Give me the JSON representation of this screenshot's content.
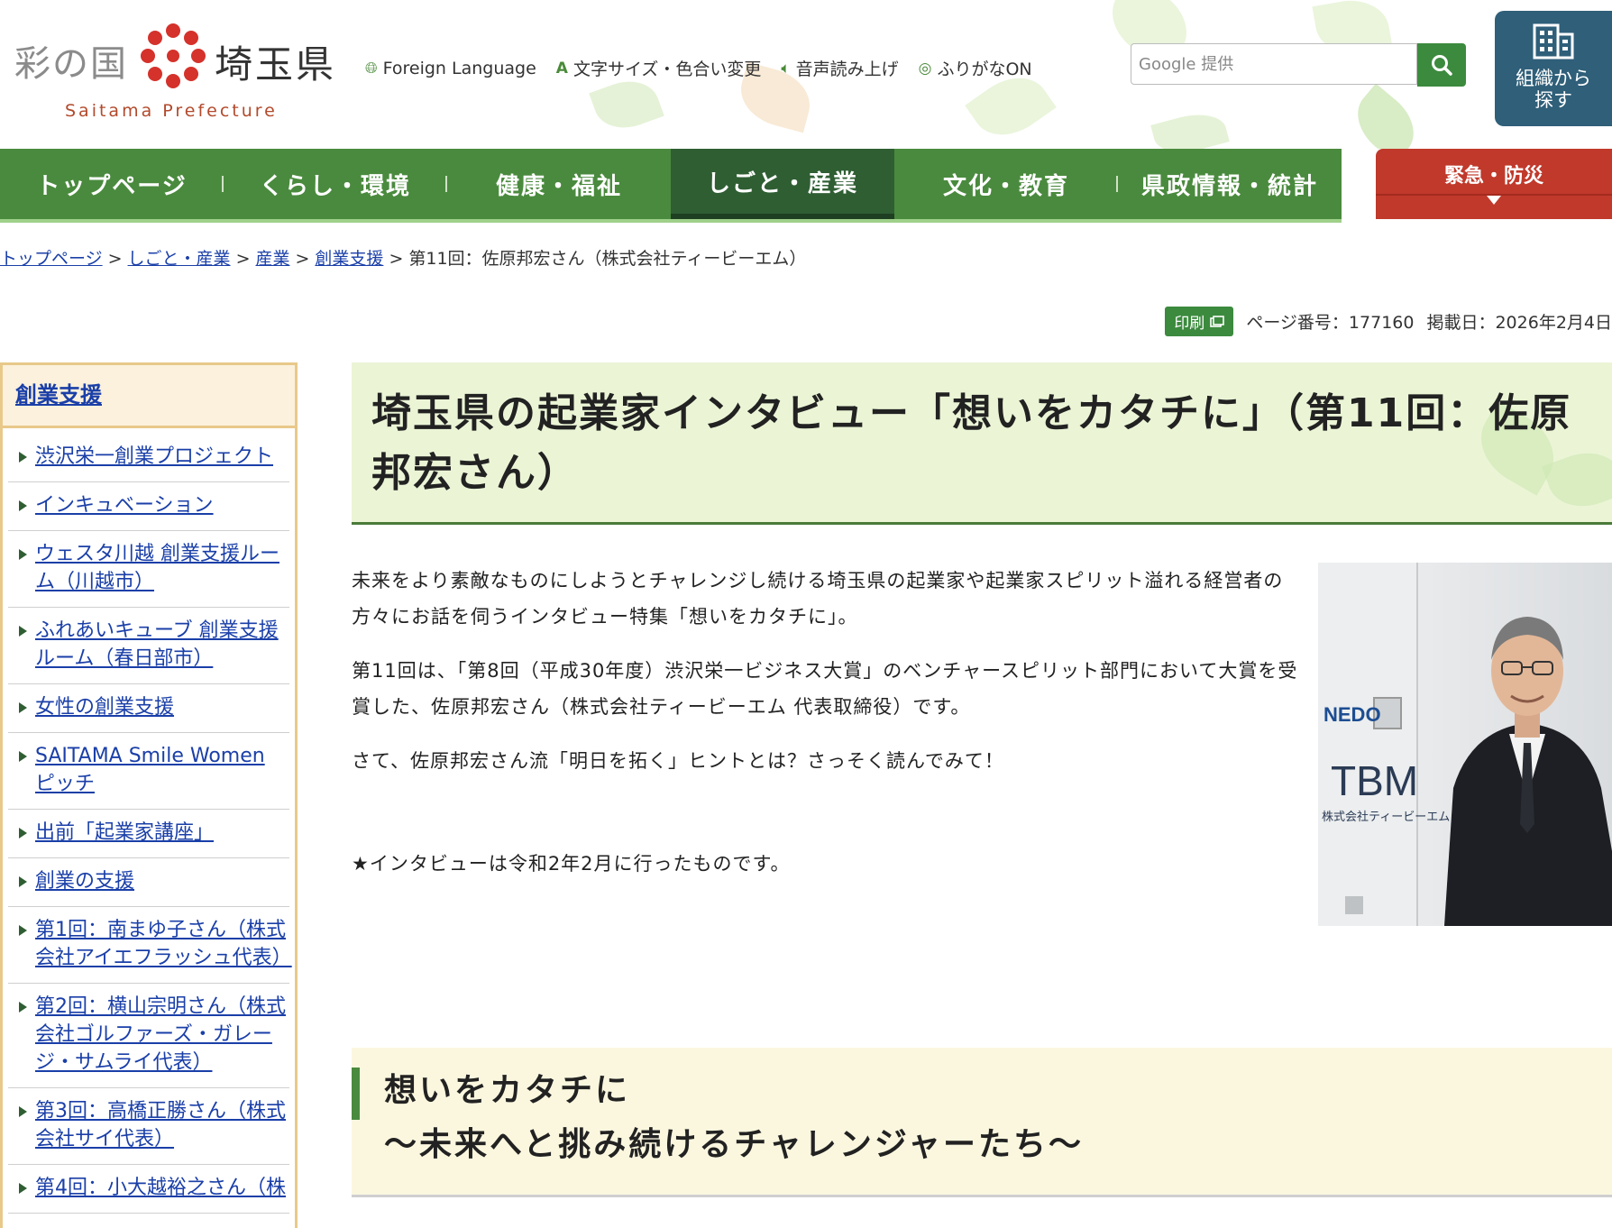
{
  "header": {
    "logo": {
      "left_text": "彩の国",
      "right_text": "埼玉県",
      "roman_text": "Saitama Prefecture"
    },
    "tools": [
      {
        "icon": "globe-icon",
        "label": "Foreign Language"
      },
      {
        "icon": "text-size-icon",
        "label": "文字サイズ・色合い変更"
      },
      {
        "icon": "speaker-icon",
        "label": "音声読み上げ"
      },
      {
        "icon": "furigana-icon",
        "label": "ふりがなON"
      }
    ],
    "search": {
      "placeholder": "Google 提供"
    },
    "org_button": {
      "label": "組織から探す"
    }
  },
  "nav": {
    "items": [
      "トップページ",
      "くらし・環境",
      "健康・福祉",
      "しごと・産業",
      "文化・教育",
      "県政情報・統計"
    ],
    "active": "しごと・産業",
    "emergency": "緊急・防災"
  },
  "breadcrumb": {
    "links": [
      "トップページ",
      "しごと・産業",
      "産業",
      "創業支援"
    ],
    "current": "第11回：佐原邦宏さん（株式会社ティービーエム）"
  },
  "meta": {
    "print": "印刷",
    "page_number": "ページ番号：177160",
    "published": "掲載日：2026年2月4日"
  },
  "sidebar": {
    "title": "創業支援",
    "items": [
      "渋沢栄一創業プロジェクト",
      "インキュベーション",
      "ウェスタ川越 創業支援ルーム（川越市）",
      "ふれあいキューブ 創業支援ルーム（春日部市）",
      "女性の創業支援",
      "SAITAMA Smile Women ピッチ",
      "出前「起業家講座」",
      "創業の支援",
      "第1回：南まゆ子さん（株式会社アイエフラッシュ代表）",
      "第2回：横山宗明さん（株式会社ゴルファーズ・ガレージ・サムライ代表）",
      "第3回：高橋正勝さん（株式会社サイ代表）",
      "第4回：小大越裕之さん（株"
    ]
  },
  "main": {
    "title": "埼玉県の起業家インタビュー「想いをカタチに」（第11回：佐原邦宏さん）",
    "paragraphs": [
      "未来をより素敵なものにしようとチャレンジし続ける埼玉県の起業家や起業家スピリット溢れる経営者の方々にお話を伺うインタビュー特集「想いをカタチに」。",
      "第11回は、「第8回（平成30年度）渋沢栄一ビジネス大賞」のベンチャースピリット部門において大賞を受賞した、佐原邦宏さん（株式会社ティービーエム 代表取締役）です。",
      "さて、佐原邦宏さん流「明日を拓く」ヒントとは？さっそく読んでみて！"
    ],
    "note": "★インタビューは令和2年2月に行ったものです。",
    "photo": {
      "nedo_text": "NEDO",
      "tbm_text": "TBM",
      "company_text": "株式会社ティービーエム"
    },
    "section_heading": [
      "想いをカタチに",
      "～未来へと挑み続けるチャレンジャーたち～"
    ]
  },
  "colors": {
    "nav_green": "#4a8a3e",
    "nav_active": "#2f5e33",
    "emergency_red": "#c0392b",
    "org_blue": "#2f5f79",
    "title_bg": "#ebf5d6",
    "sidebar_border": "#e8c98a"
  }
}
